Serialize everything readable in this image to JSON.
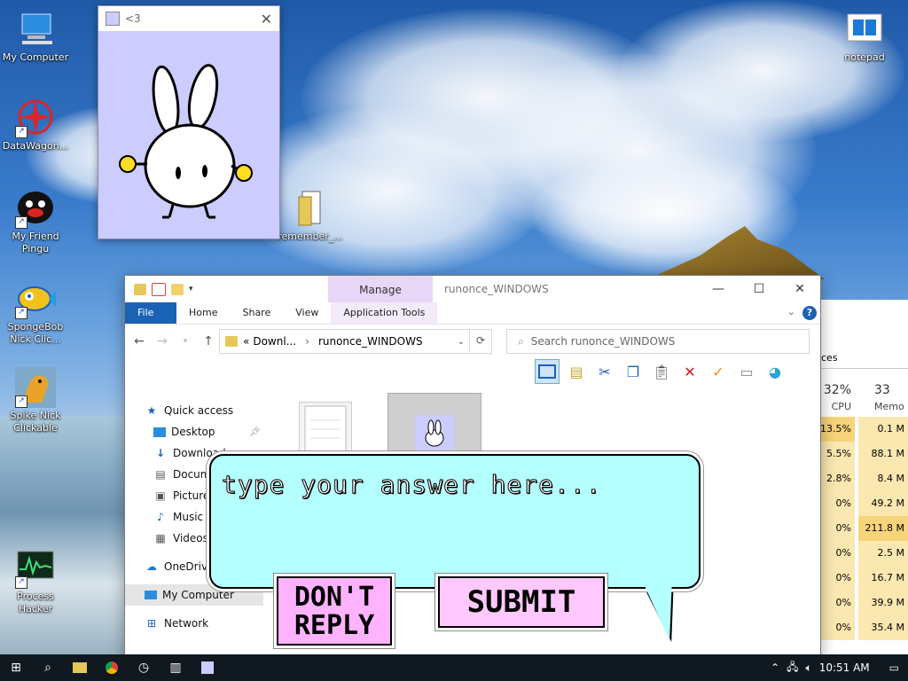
{
  "desktop": {
    "icons": [
      {
        "label": "My Computer"
      },
      {
        "label": "DataWagon..."
      },
      {
        "label": "My Friend Pingu"
      },
      {
        "label": "SpongeBob Nick Clic..."
      },
      {
        "label": "Spike Nick Clickable"
      },
      {
        "label": "Process Hacker"
      },
      {
        "label": "remember_..."
      },
      {
        "label": "notepad"
      }
    ]
  },
  "bunny_window": {
    "title": "<3",
    "close": "✕"
  },
  "explorer": {
    "manage_tab": "Manage",
    "window_title": "runonce_WINDOWS",
    "controls": {
      "minimize": "—",
      "maximize": "☐",
      "close": "✕"
    },
    "ribbon_tabs": [
      "File",
      "Home",
      "Share",
      "View",
      "Application Tools"
    ],
    "address": {
      "prefix": "«",
      "crumb1": "Downl...",
      "sep": "›",
      "crumb2": "runonce_WINDOWS"
    },
    "search_placeholder": "Search runonce_WINDOWS",
    "nav": {
      "quick_access": "Quick access",
      "items": [
        "Desktop",
        "Downloads",
        "Documents",
        "Pictures",
        "Music",
        "Videos"
      ],
      "onedrive": "OneDrive",
      "my_computer": "My Computer",
      "network": "Network"
    }
  },
  "task_manager": {
    "tab": "ces",
    "cpu_pct": "32%",
    "cpu_label": "CPU",
    "mem_pct": "33",
    "mem_label": "Memo",
    "rows": [
      {
        "cpu": "13.5%",
        "mem": "0.1 M"
      },
      {
        "cpu": "5.5%",
        "mem": "88.1 M"
      },
      {
        "cpu": "2.8%",
        "mem": "8.4 M"
      },
      {
        "cpu": "0%",
        "mem": "49.2 M"
      },
      {
        "cpu": "0%",
        "mem": "211.8 M"
      },
      {
        "cpu": "0%",
        "mem": "2.5 M"
      },
      {
        "cpu": "0%",
        "mem": "16.7 M"
      },
      {
        "cpu": "0%",
        "mem": "39.9 M"
      },
      {
        "cpu": "0%",
        "mem": "35.4 M"
      }
    ]
  },
  "dialog": {
    "placeholder": "type your answer here...",
    "dont_reply": "DON'T REPLY",
    "submit": "SUBMIT"
  },
  "taskbar": {
    "time": "10:51 AM"
  },
  "colors": {
    "bubble": "#b4ffff",
    "button_pink": "#ffb3ff",
    "bunny_bg": "#ccccff",
    "accent": "#1a62b6"
  }
}
